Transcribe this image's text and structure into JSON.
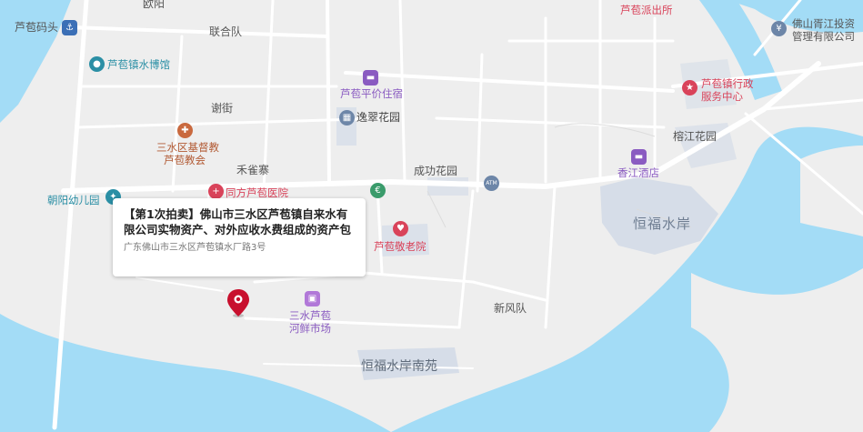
{
  "map": {
    "colors": {
      "water": "#a3dcf6",
      "land": "#eeeeee",
      "road": "#ffffff",
      "building": "#d6dde8",
      "pin": "#c8102e"
    },
    "places": {
      "luboumatou": "芦苞码头",
      "ouyang": "欧阳",
      "lianhedui": "联合队",
      "luboushuibowuguan": "芦苞镇水博馆",
      "xiejie": "谢街",
      "hequezhai": "禾雀寨",
      "chaoyangyoueryuan": "朝阳幼儿园",
      "tongfangluboyiyuan": "同方芦苞医院",
      "sanshuijidujiao": "三水区基督教",
      "lubojiaohui": "芦苞教会",
      "lubopaichusuo": "芦苞派出所",
      "lubopingjiazhusu": "芦苞平价住宿",
      "yicuihuayuan": "逸翠花园",
      "chenggonghuayuan": "成功花园",
      "atm": "ATM",
      "lubojinglaoyuan": "芦苞敬老院",
      "luboxingzheng_1": "芦苞镇行政",
      "luboxingzheng_2": "服务中心",
      "rongjianghuayuan": "榕江花园",
      "xiangjiangjiudian": "香江酒店",
      "hengfushuian": "恒福水岸",
      "foshanqingjiang_1": "佛山胥江投资",
      "foshanqingjiang_2": "管理有限公司",
      "xinfengdui": "新风队",
      "shichang_1": "三水芦苞",
      "shichang_2": "河鲜市场",
      "hengfunanyuan": "恒福水岸南苑"
    },
    "popup": {
      "title": "【第1次拍卖】佛山市三水区芦苞镇自来水有限公司实物资产、对外应收水费组成的资产包",
      "address": "广东佛山市三水区芦苞镇水厂路3号"
    }
  }
}
